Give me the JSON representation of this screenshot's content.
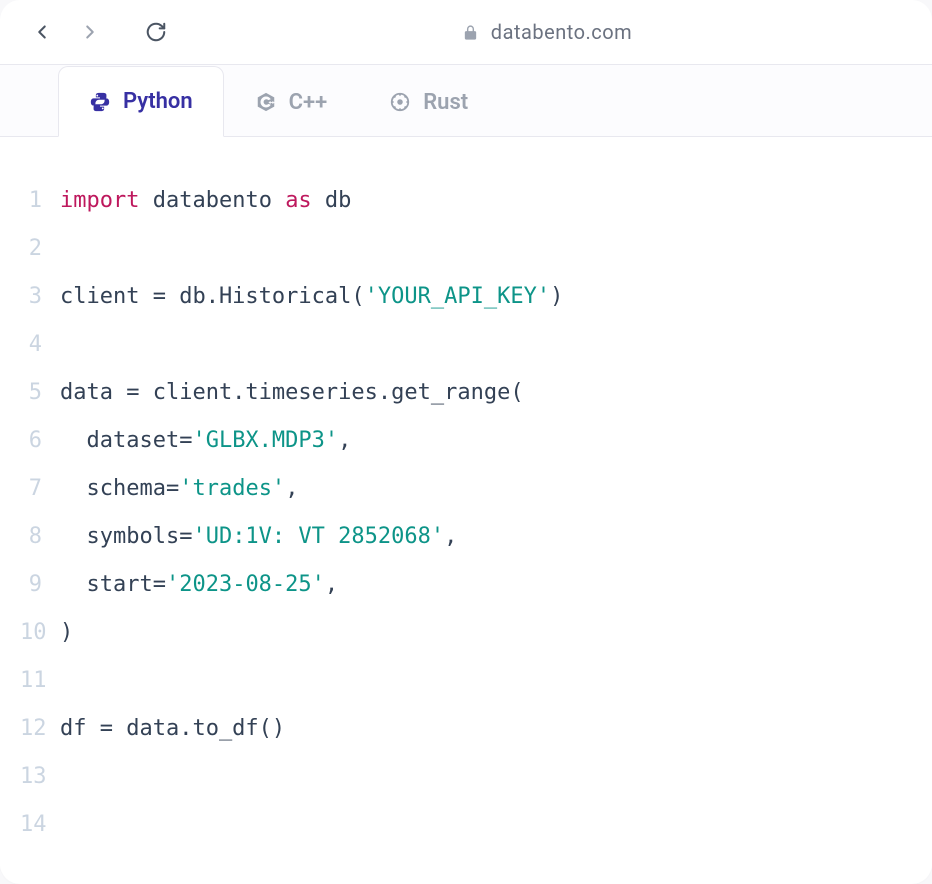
{
  "toolbar": {
    "url": "databento.com"
  },
  "tabs": [
    {
      "id": "python",
      "label": "Python",
      "active": true
    },
    {
      "id": "cpp",
      "label": "C++",
      "active": false
    },
    {
      "id": "rust",
      "label": "Rust",
      "active": false
    }
  ],
  "code": {
    "lines": [
      [
        {
          "t": "kw",
          "v": "import"
        },
        {
          "t": "plain",
          "v": " databento "
        },
        {
          "t": "kw",
          "v": "as"
        },
        {
          "t": "plain",
          "v": " db"
        }
      ],
      [],
      [
        {
          "t": "plain",
          "v": "client = db.Historical("
        },
        {
          "t": "str",
          "v": "'YOUR_API_KEY'"
        },
        {
          "t": "plain",
          "v": ")"
        }
      ],
      [],
      [
        {
          "t": "plain",
          "v": "data = client.timeseries.get_range("
        }
      ],
      [
        {
          "t": "plain",
          "v": "  dataset="
        },
        {
          "t": "str",
          "v": "'GLBX.MDP3'"
        },
        {
          "t": "plain",
          "v": ","
        }
      ],
      [
        {
          "t": "plain",
          "v": "  schema="
        },
        {
          "t": "str",
          "v": "'trades'"
        },
        {
          "t": "plain",
          "v": ","
        }
      ],
      [
        {
          "t": "plain",
          "v": "  symbols="
        },
        {
          "t": "str",
          "v": "'UD:1V: VT 2852068'"
        },
        {
          "t": "plain",
          "v": ","
        }
      ],
      [
        {
          "t": "plain",
          "v": "  start="
        },
        {
          "t": "str",
          "v": "'2023-08-25'"
        },
        {
          "t": "plain",
          "v": ","
        }
      ],
      [
        {
          "t": "plain",
          "v": ")"
        }
      ],
      [],
      [
        {
          "t": "plain",
          "v": "df = data.to_df()"
        }
      ],
      [],
      []
    ]
  }
}
